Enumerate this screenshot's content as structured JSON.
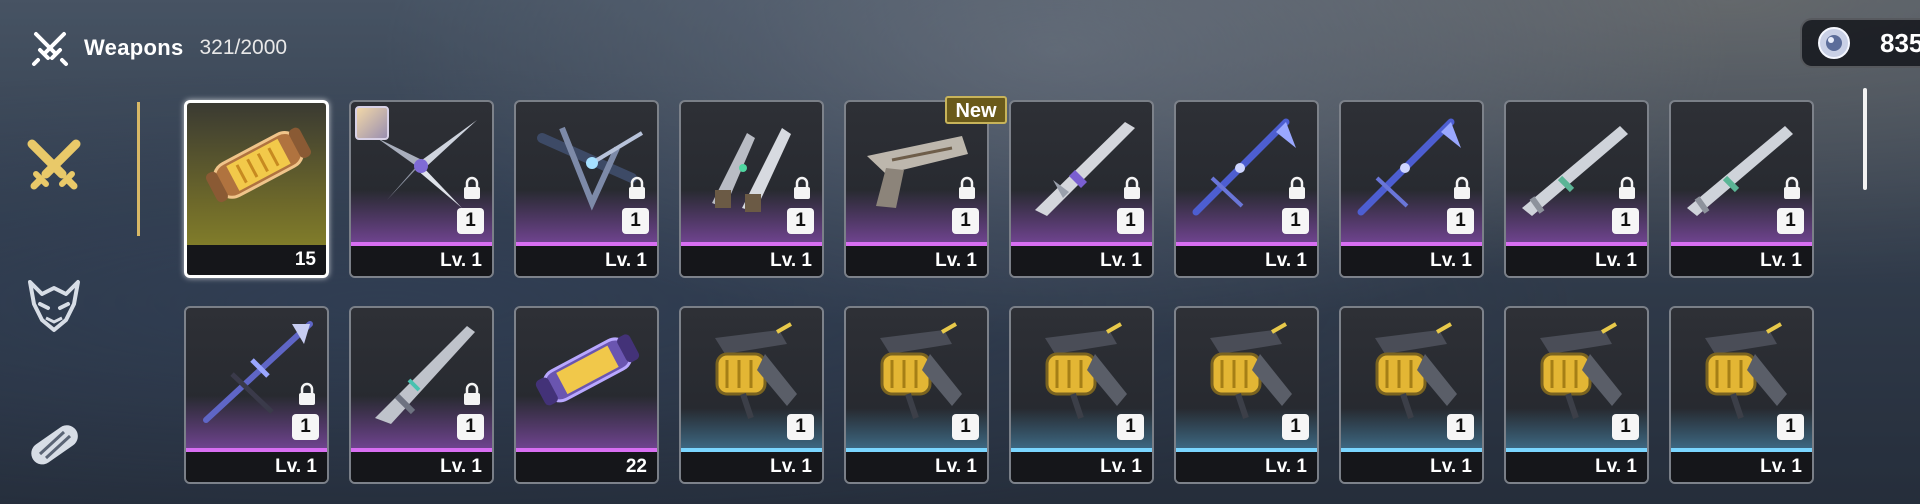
{
  "header": {
    "title": "Weapons",
    "count": "321/2000",
    "icon": "crossed-swords-icon"
  },
  "currency": {
    "value": "835",
    "icon": "crystal-coin-icon"
  },
  "sidebar": [
    {
      "name": "weapons-tab",
      "icon": "crossed-swords-icon",
      "active": true
    },
    {
      "name": "matrices-tab",
      "icon": "demon-mask-icon",
      "active": false
    },
    {
      "name": "materials-tab",
      "icon": "capsule-pack-icon",
      "active": false
    }
  ],
  "new_badge": "New",
  "colors": {
    "accent": "#d8b866",
    "purple": "#d86ef2",
    "blue": "#7ad6ff",
    "gold": "#e6d85c"
  },
  "rows": [
    [
      {
        "type": "capsule",
        "label": "15",
        "rarity": "gold",
        "selected": true
      },
      {
        "type": "weapon",
        "art": "star-blade",
        "label": "Lv. 1",
        "qty": "1",
        "locked": true,
        "rarity": "purple",
        "avatar": true
      },
      {
        "type": "weapon",
        "art": "crossbow",
        "label": "Lv. 1",
        "qty": "1",
        "locked": true,
        "rarity": "purple"
      },
      {
        "type": "weapon",
        "art": "twin-blades",
        "label": "Lv. 1",
        "qty": "1",
        "locked": true,
        "rarity": "purple"
      },
      {
        "type": "weapon",
        "art": "gun",
        "label": "Lv. 1",
        "qty": "1",
        "locked": true,
        "rarity": "purple",
        "new": true
      },
      {
        "type": "weapon",
        "art": "long-sword",
        "label": "Lv. 1",
        "qty": "1",
        "locked": true,
        "rarity": "purple"
      },
      {
        "type": "weapon",
        "art": "blue-scythe",
        "label": "Lv. 1",
        "qty": "1",
        "locked": true,
        "rarity": "purple"
      },
      {
        "type": "weapon",
        "art": "blue-scythe",
        "label": "Lv. 1",
        "qty": "1",
        "locked": true,
        "rarity": "purple"
      },
      {
        "type": "weapon",
        "art": "silver-sword",
        "label": "Lv. 1",
        "qty": "1",
        "locked": true,
        "rarity": "purple"
      },
      {
        "type": "weapon",
        "art": "silver-sword",
        "label": "Lv. 1",
        "qty": "1",
        "locked": true,
        "rarity": "purple"
      }
    ],
    [
      {
        "type": "weapon",
        "art": "blue-spear",
        "label": "Lv. 1",
        "qty": "1",
        "locked": true,
        "rarity": "purple"
      },
      {
        "type": "weapon",
        "art": "lance",
        "label": "Lv. 1",
        "qty": "1",
        "locked": true,
        "rarity": "purple"
      },
      {
        "type": "capsule-purple",
        "label": "22",
        "rarity": "purple"
      },
      {
        "type": "weapon",
        "art": "gold-cannon",
        "label": "Lv. 1",
        "qty": "1",
        "locked": false,
        "rarity": "blue"
      },
      {
        "type": "weapon",
        "art": "gold-cannon",
        "label": "Lv. 1",
        "qty": "1",
        "locked": false,
        "rarity": "blue"
      },
      {
        "type": "weapon",
        "art": "gold-cannon",
        "label": "Lv. 1",
        "qty": "1",
        "locked": false,
        "rarity": "blue"
      },
      {
        "type": "weapon",
        "art": "gold-cannon",
        "label": "Lv. 1",
        "qty": "1",
        "locked": false,
        "rarity": "blue"
      },
      {
        "type": "weapon",
        "art": "gold-cannon",
        "label": "Lv. 1",
        "qty": "1",
        "locked": false,
        "rarity": "blue"
      },
      {
        "type": "weapon",
        "art": "gold-cannon",
        "label": "Lv. 1",
        "qty": "1",
        "locked": false,
        "rarity": "blue"
      },
      {
        "type": "weapon",
        "art": "gold-cannon",
        "label": "Lv. 1",
        "qty": "1",
        "locked": false,
        "rarity": "blue"
      }
    ]
  ]
}
